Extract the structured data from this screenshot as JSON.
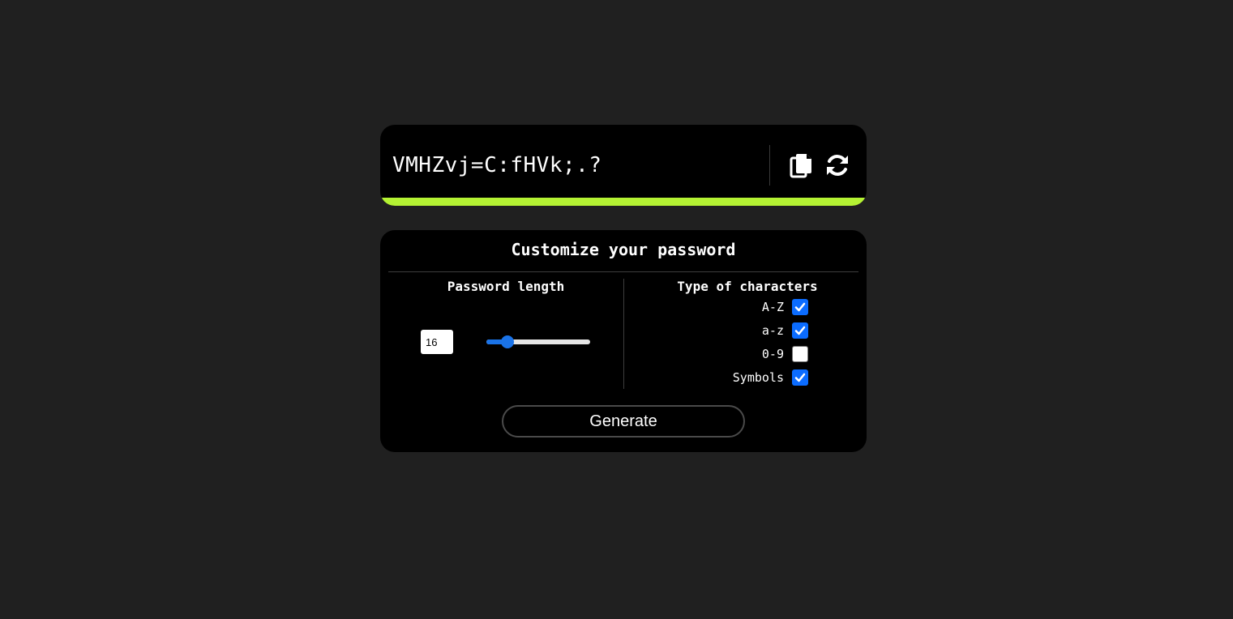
{
  "generator": {
    "password": "VMHZvj=C:fHVk;.?",
    "copy_icon": "copy-icon",
    "refresh_icon": "refresh-icon",
    "strength_color": "#b4f233",
    "strength_fraction": 1.0
  },
  "settings": {
    "title": "Customize your password",
    "length": {
      "label": "Password length",
      "value": "16",
      "slider": {
        "min": 4,
        "max": 64,
        "value": 16,
        "accent": "#1a73e8"
      }
    },
    "types": {
      "label": "Type of characters",
      "options": [
        {
          "label": "A-Z",
          "checked": true
        },
        {
          "label": "a-z",
          "checked": true
        },
        {
          "label": "0-9",
          "checked": false
        },
        {
          "label": "Symbols",
          "checked": true
        }
      ]
    },
    "generate_label": "Generate"
  }
}
